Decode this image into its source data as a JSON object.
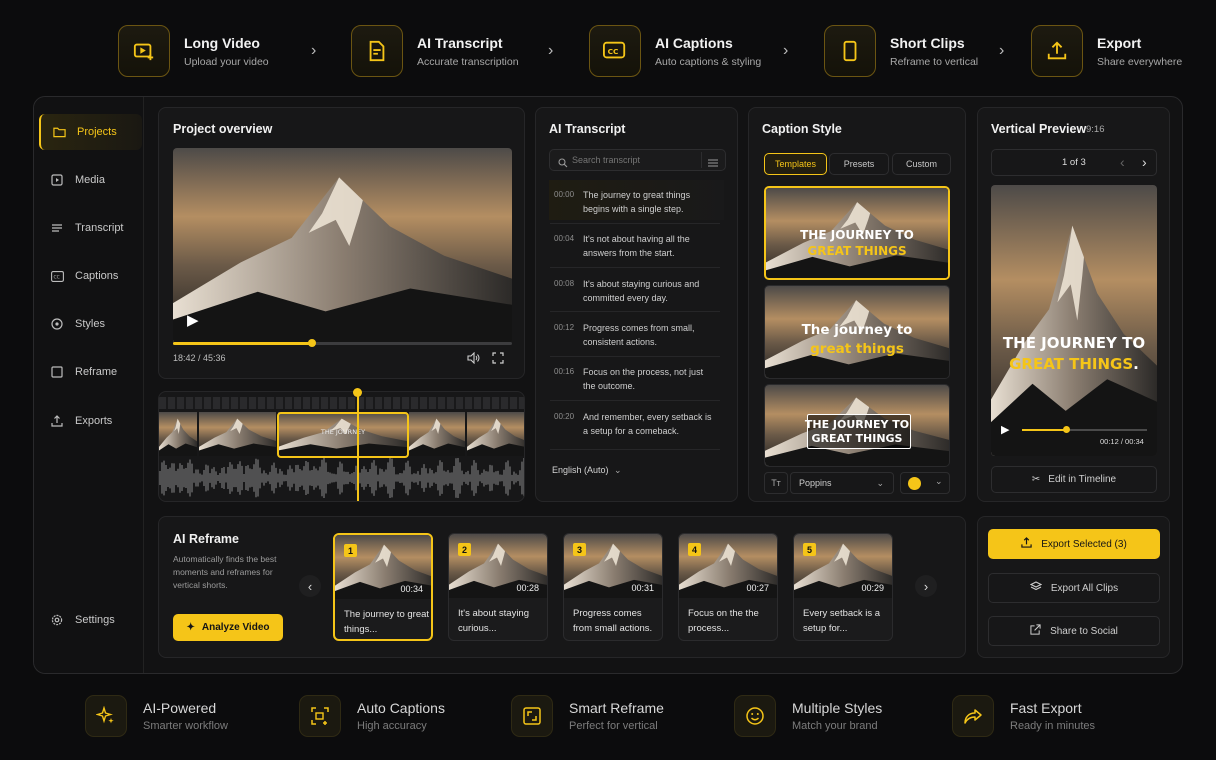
{
  "steps": [
    {
      "title": "Long Video",
      "sub": "Upload your video",
      "icon": "video-icon"
    },
    {
      "title": "AI Transcript",
      "sub": "Accurate transcription",
      "icon": "document-icon"
    },
    {
      "title": "AI Captions",
      "sub": "Auto captions & styling",
      "icon": "cc-icon"
    },
    {
      "title": "Short Clips",
      "sub": "Reframe to vertical",
      "icon": "phone-icon"
    },
    {
      "title": "Export",
      "sub": "Share everywhere",
      "icon": "upload-icon"
    }
  ],
  "sidebar": {
    "items": [
      "Projects",
      "Media",
      "Transcript",
      "Captions",
      "Styles",
      "Reframe",
      "Exports"
    ],
    "settings": "Settings"
  },
  "overview": {
    "title": "Project overview",
    "time": "18:42 / 45:36",
    "progress": 0.41
  },
  "timeline": {
    "label": "THE JOURNEY"
  },
  "transcript": {
    "title": "AI Transcript",
    "search_placeholder": "Search transcript",
    "language": "English (Auto)",
    "lines": [
      {
        "ts": "00:00",
        "text": "The journey to great things begins with a single step."
      },
      {
        "ts": "00:04",
        "text": "It's not about having all the answers from the start."
      },
      {
        "ts": "00:08",
        "text": "It's about staying curious and committed every day."
      },
      {
        "ts": "00:12",
        "text": "Progress comes from small, consistent actions."
      },
      {
        "ts": "00:16",
        "text": "Focus on the process, not just the outcome."
      },
      {
        "ts": "00:20",
        "text": "And remember, every setback is a setup for a comeback."
      }
    ]
  },
  "caption_style": {
    "title": "Caption Style",
    "tabs": [
      "Templates",
      "Presets",
      "Custom"
    ],
    "t1a": "THE JOURNEY TO",
    "t1b": "GREAT THINGS",
    "t2a": "The journey to",
    "t2b": "great things",
    "t3a": "THE JOURNEY TO",
    "t3b": "GREAT THINGS",
    "font": "Poppins",
    "swatch_color": "#f5c518"
  },
  "vertical": {
    "title": "Vertical Preview",
    "ratio": "9:16",
    "pager": "1 of 3",
    "line1": "THE JOURNEY TO",
    "line2": "GREAT THINGS",
    "line2_dot": ".",
    "time": "00:12 / 00:34",
    "progress": 0.35,
    "edit": "Edit in Timeline"
  },
  "reframe": {
    "title": "AI Reframe",
    "desc": "Automatically finds the best moments and reframes for vertical shorts.",
    "button": "Analyze Video",
    "clips": [
      {
        "n": "1",
        "dur": "00:34",
        "text": "The journey to great things..."
      },
      {
        "n": "2",
        "dur": "00:28",
        "text": "It's about staying curious..."
      },
      {
        "n": "3",
        "dur": "00:31",
        "text": "Progress comes from small actions."
      },
      {
        "n": "4",
        "dur": "00:27",
        "text": "Focus on the the process..."
      },
      {
        "n": "5",
        "dur": "00:29",
        "text": "Every setback is a setup for..."
      }
    ]
  },
  "export": {
    "selected": "Export Selected (3)",
    "all": "Export All Clips",
    "social": "Share to Social"
  },
  "features": [
    {
      "title": "AI-Powered",
      "sub": "Smarter workflow",
      "icon": "sparkle-icon"
    },
    {
      "title": "Auto Captions",
      "sub": "High accuracy",
      "icon": "captions-icon"
    },
    {
      "title": "Smart Reframe",
      "sub": "Perfect for vertical",
      "icon": "reframe-icon"
    },
    {
      "title": "Multiple Styles",
      "sub": "Match your brand",
      "icon": "smiley-icon"
    },
    {
      "title": "Fast Export",
      "sub": "Ready in minutes",
      "icon": "share-icon"
    }
  ],
  "colors": {
    "accent": "#f5c518",
    "bg": "#0c0c0d",
    "panel": "#171718"
  }
}
